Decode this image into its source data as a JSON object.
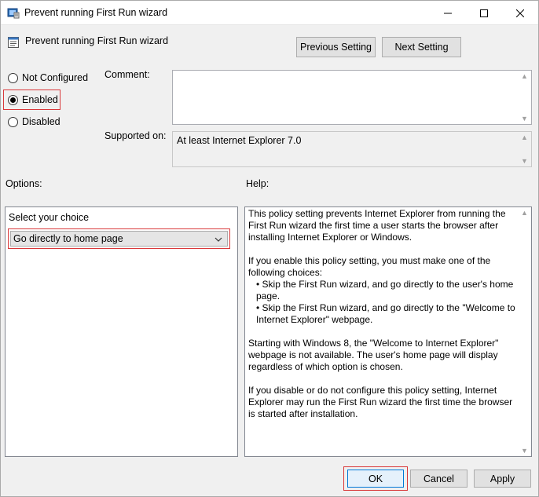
{
  "window": {
    "title": "Prevent running First Run wizard",
    "controls": {
      "minimize_icon": "minimize-icon",
      "maximize_icon": "maximize-icon",
      "close_icon": "close-icon"
    }
  },
  "header": {
    "title": "Prevent running First Run wizard",
    "prev_button": "Previous Setting",
    "next_button": "Next Setting"
  },
  "state": {
    "options": [
      "Not Configured",
      "Enabled",
      "Disabled"
    ],
    "selected": "Enabled"
  },
  "comment": {
    "label": "Comment:",
    "value": ""
  },
  "supported": {
    "label": "Supported on:",
    "value": "At least Internet Explorer 7.0"
  },
  "options_section": {
    "label": "Options:",
    "choice_label": "Select your choice",
    "choice_value": "Go directly to home page"
  },
  "help": {
    "label": "Help:",
    "p1": "This policy setting prevents Internet Explorer from running the First Run wizard the first time a user starts the browser after installing Internet Explorer or Windows.",
    "p2": "If you enable this policy setting, you must make one of the following choices:",
    "b1": "• Skip the First Run wizard, and go directly to the user's home page.",
    "b2": "• Skip the First Run wizard, and go directly to the \"Welcome to Internet Explorer\" webpage.",
    "p3": "Starting with Windows 8, the \"Welcome to Internet Explorer\" webpage is not available. The user's home page will display regardless of which option is chosen.",
    "p4": "If you disable or do not configure this policy setting, Internet Explorer may run the First Run wizard the first time the browser is started after installation."
  },
  "footer": {
    "ok": "OK",
    "cancel": "Cancel",
    "apply": "Apply"
  },
  "colors": {
    "highlight": "#d9383a",
    "accent": "#0078d7"
  }
}
